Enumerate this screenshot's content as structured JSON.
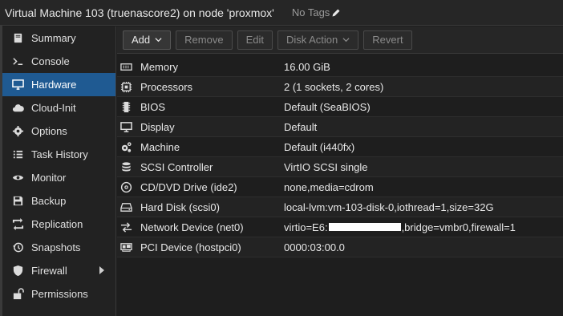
{
  "header": {
    "title": "Virtual Machine 103 (truenascore2) on node 'proxmox'",
    "tags_label": "No Tags"
  },
  "sidebar": {
    "items": [
      {
        "label": "Summary",
        "icon": "book-icon"
      },
      {
        "label": "Console",
        "icon": "terminal-icon"
      },
      {
        "label": "Hardware",
        "icon": "monitor-icon",
        "active": true
      },
      {
        "label": "Cloud-Init",
        "icon": "cloud-icon"
      },
      {
        "label": "Options",
        "icon": "gear-icon"
      },
      {
        "label": "Task History",
        "icon": "list-icon"
      },
      {
        "label": "Monitor",
        "icon": "eye-icon"
      },
      {
        "label": "Backup",
        "icon": "floppy-icon"
      },
      {
        "label": "Replication",
        "icon": "retweet-icon"
      },
      {
        "label": "Snapshots",
        "icon": "history-icon"
      },
      {
        "label": "Firewall",
        "icon": "shield-icon",
        "expandable": true
      },
      {
        "label": "Permissions",
        "icon": "unlock-icon"
      }
    ]
  },
  "toolbar": {
    "add_label": "Add",
    "remove_label": "Remove",
    "edit_label": "Edit",
    "disk_action_label": "Disk Action",
    "revert_label": "Revert"
  },
  "hardware": {
    "rows": [
      {
        "key": "Memory",
        "value": "16.00 GiB",
        "icon": "memory-icon"
      },
      {
        "key": "Processors",
        "value": "2 (1 sockets, 2 cores)",
        "icon": "cpu-icon"
      },
      {
        "key": "BIOS",
        "value": "Default (SeaBIOS)",
        "icon": "microchip-icon"
      },
      {
        "key": "Display",
        "value": "Default",
        "icon": "desktop-icon"
      },
      {
        "key": "Machine",
        "value": "Default (i440fx)",
        "icon": "cogs-icon"
      },
      {
        "key": "SCSI Controller",
        "value": "VirtIO SCSI single",
        "icon": "database-icon"
      },
      {
        "key": "CD/DVD Drive (ide2)",
        "value": "none,media=cdrom",
        "icon": "disc-icon"
      },
      {
        "key": "Hard Disk (scsi0)",
        "value": "local-lvm:vm-103-disk-0,iothread=1,size=32G",
        "icon": "hdd-icon"
      },
      {
        "key": "Network Device (net0)",
        "value_prefix": "virtio=E6:",
        "value_suffix": ",bridge=vmbr0,firewall=1",
        "icon": "exchange-icon"
      },
      {
        "key": "PCI Device (hostpci0)",
        "value": "0000:03:00.0",
        "icon": "pci-card-icon"
      }
    ]
  },
  "colors": {
    "background": "#1e1e1e",
    "active_item": "#1f5a92",
    "text": "#e8e8e8",
    "disabled_text": "#8a8a8a"
  }
}
